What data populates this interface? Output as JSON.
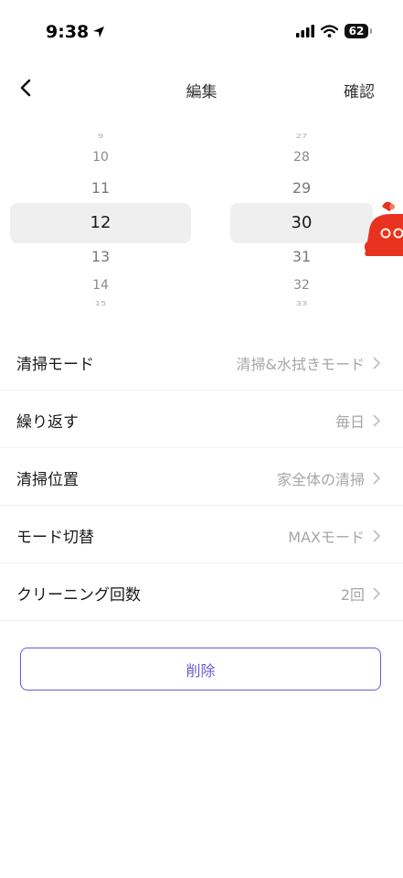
{
  "status_bar": {
    "time": "9:38",
    "battery": "62"
  },
  "nav": {
    "title": "編集",
    "confirm": "確認"
  },
  "picker": {
    "hours": [
      "9",
      "10",
      "11",
      "12",
      "13",
      "14",
      "15"
    ],
    "minutes": [
      "27",
      "28",
      "29",
      "30",
      "31",
      "32",
      "33"
    ],
    "selected_hour": "12",
    "selected_minute": "30"
  },
  "settings": [
    {
      "label": "清掃モード",
      "value": "清掃&水拭きモード"
    },
    {
      "label": "繰り返す",
      "value": "毎日"
    },
    {
      "label": "清掃位置",
      "value": "家全体の清掃"
    },
    {
      "label": "モード切替",
      "value": "MAXモード"
    },
    {
      "label": "クリーニング回数",
      "value": "2回"
    }
  ],
  "delete_label": "削除",
  "colors": {
    "accent": "#6b59d3",
    "mascot": "#e8321f"
  },
  "icons": [
    "location-arrow-icon",
    "signal-icon",
    "wifi-icon",
    "battery-icon",
    "back-chevron-icon",
    "chevron-right-icon",
    "mascot-icon"
  ]
}
